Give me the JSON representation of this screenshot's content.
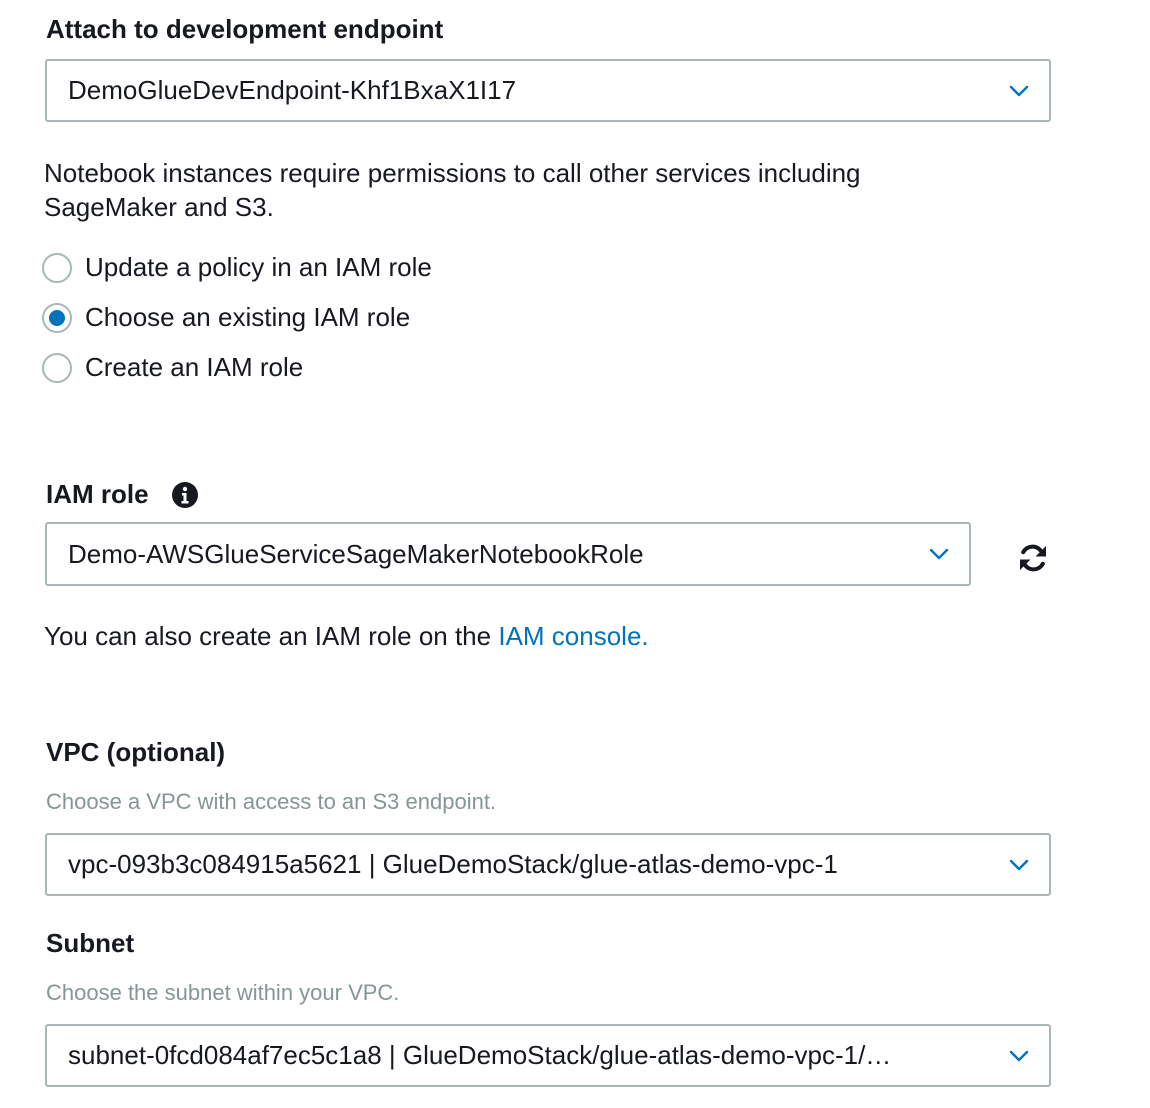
{
  "endpoint": {
    "label": "Attach to development endpoint",
    "value": "DemoGlueDevEndpoint-Khf1BxaX1I17"
  },
  "permissions": {
    "description_line1": "Notebook instances require permissions to call other services including",
    "description_line2": "SageMaker and S3.",
    "options": [
      {
        "label": "Update a policy in an IAM role",
        "checked": false
      },
      {
        "label": "Choose an existing IAM role",
        "checked": true
      },
      {
        "label": "Create an IAM role",
        "checked": false
      }
    ]
  },
  "iam_role": {
    "label": "IAM role",
    "info_icon": "info-icon",
    "value": "Demo-AWSGlueServiceSageMakerNotebookRole",
    "refresh_icon": "refresh-icon",
    "help_prefix": "You can also create an IAM role on the",
    "help_link": "IAM console."
  },
  "vpc": {
    "label": "VPC (optional)",
    "hint": "Choose a VPC with access to an S3 endpoint.",
    "value": "vpc-093b3c084915a5621 | GlueDemoStack/glue-atlas-demo-vpc-1"
  },
  "subnet": {
    "label": "Subnet",
    "hint": "Choose the subnet within your VPC.",
    "value": "subnet-0fcd084af7ec5c1a8 | GlueDemoStack/glue-atlas-demo-vpc-1/…"
  },
  "colors": {
    "accent": "#0073bb",
    "border": "#aab7b8",
    "hint": "#879596",
    "text": "#16191f"
  }
}
